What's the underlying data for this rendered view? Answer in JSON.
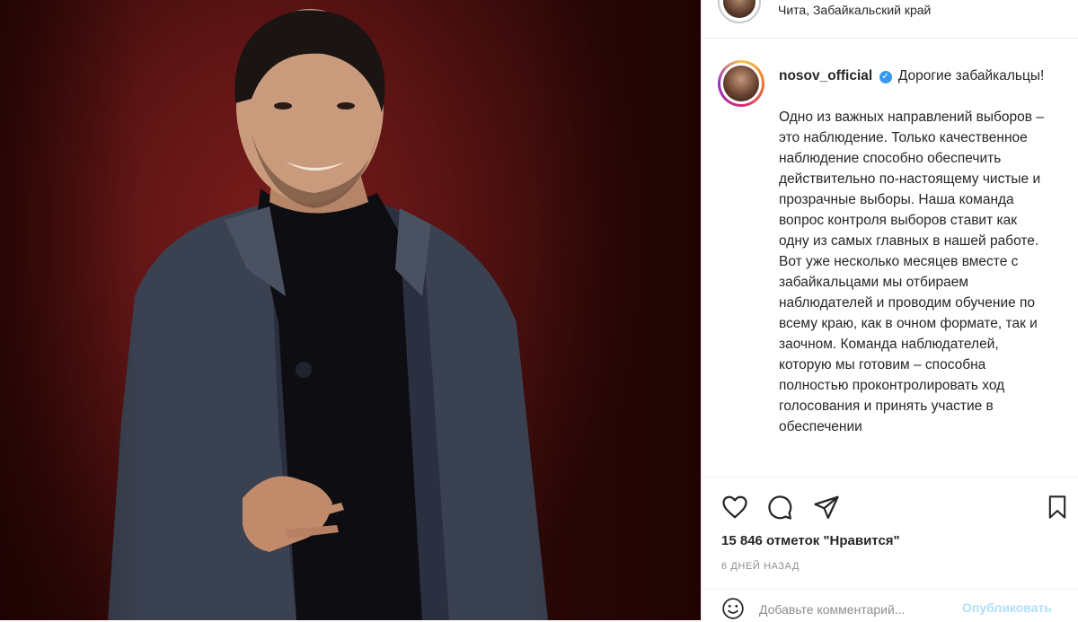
{
  "post": {
    "location": "Чита, Забайкальский край",
    "username": "nosov_official",
    "caption_lead": "Дорогие забайкальцы!",
    "caption_body": "Одно из важных направлений выборов – это наблюдение. Только качественное наблюдение способно обеспечить действительно по-настоящему чистые и прозрачные выборы. Наша команда вопрос контроля выборов ставит как одну из самых главных в нашей работе. Вот уже несколько месяцев вместе с забайкальцами мы отбираем наблюдателей и проводим обучение по всему краю, как в очном формате, так и заочном. Команда наблюдателей, которую мы готовим – способна полностью проконтролировать ход голосования и принять участие в обеспечении",
    "likes": "15 846 отметок \"Нравится\"",
    "time": "6 ДНЕЙ НАЗАД"
  },
  "comment": {
    "placeholder": "Добавьте комментарий...",
    "post_label": "Опубликовать"
  },
  "icons": {
    "like": "heart-icon",
    "comment": "comment-icon",
    "share": "share-icon",
    "save": "bookmark-icon",
    "emoji": "emoji-icon",
    "verified": "verified-icon"
  },
  "colors": {
    "background": "#5c1414",
    "verified": "#3897f0",
    "post_disabled": "#b2dffc"
  }
}
